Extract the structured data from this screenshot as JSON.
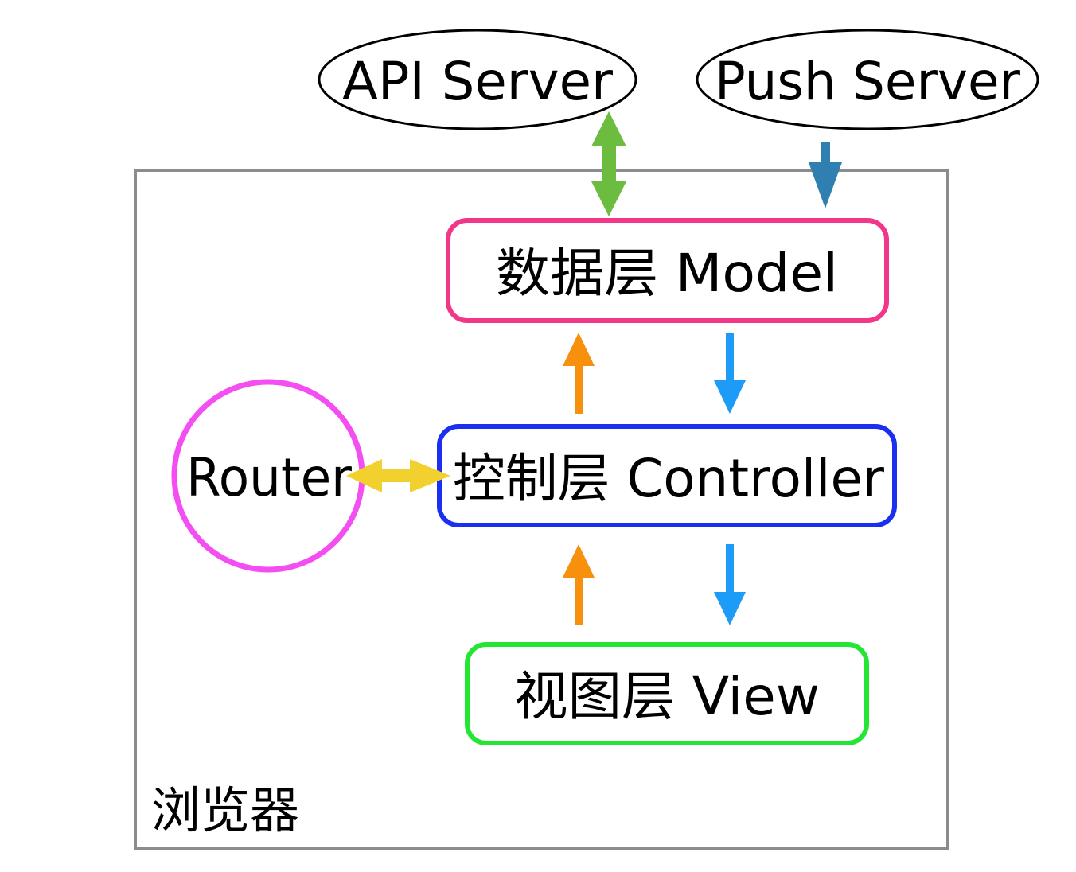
{
  "diagram": {
    "external": {
      "api_server": "API Server",
      "push_server": "Push Server"
    },
    "browser": {
      "label": "浏览器"
    },
    "layers": {
      "model": "数据层 Model",
      "controller": "控制层 Controller",
      "view": "视图层 View"
    },
    "router": {
      "label": "Router"
    }
  },
  "colors": {
    "browser_border": "#8c8c8c",
    "model_border": "#f2378a",
    "controller_border": "#1a2ff0",
    "view_border": "#22e633",
    "router_border": "#f44df2",
    "api_arrow": "#6cbd3f",
    "push_arrow": "#2f7fb0",
    "up_arrow": "#f7900d",
    "down_arrow": "#1c9bf7",
    "router_arrow": "#f2d02d",
    "ellipse_stroke": "#000000"
  }
}
